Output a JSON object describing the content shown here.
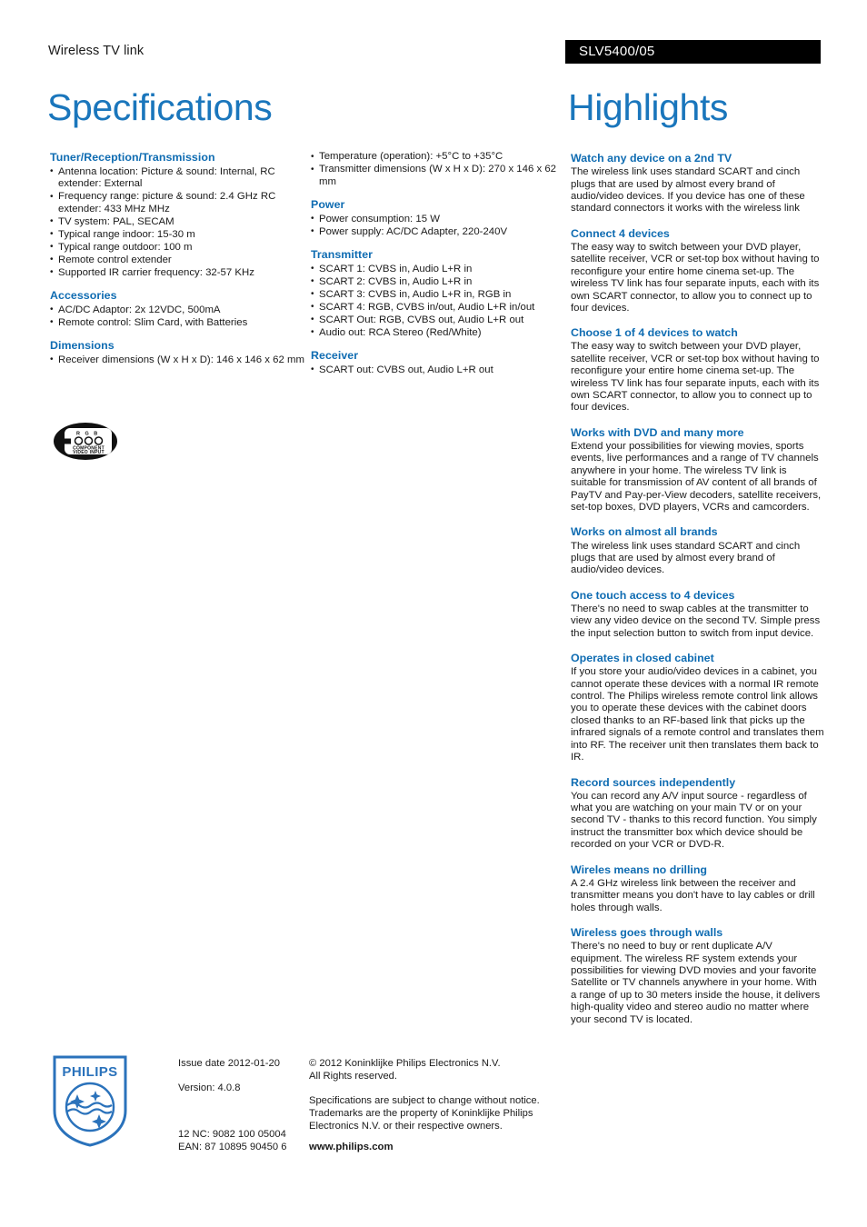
{
  "header": {
    "kicker": "Wireless TV link",
    "product_code": "SLV5400/05"
  },
  "titles": {
    "specifications": "Specifications",
    "highlights": "Highlights"
  },
  "badge": {
    "label_r": "R",
    "label_g": "G",
    "label_b": "B",
    "line1": "COMPONENT",
    "line2": "VIDEO INPUT"
  },
  "colors": {
    "title_blue": "#1a76bc",
    "heading_blue": "#0f6cb2",
    "code_bar_bg": "#000000",
    "logo_blue": "#2a72bb"
  },
  "spec_sections": [
    {
      "column": "left",
      "heading": "Tuner/Reception/Transmission",
      "items": [
        "Antenna location: Picture & sound: Internal, RC extender: External",
        "Frequency range: picture & sound: 2.4 GHz RC extender: 433 MHz MHz",
        "TV system: PAL, SECAM",
        "Typical range indoor: 15-30 m",
        "Typical range outdoor: 100 m",
        "Remote control extender",
        "Supported IR carrier frequency: 32-57 KHz"
      ]
    },
    {
      "column": "left",
      "heading": "Accessories",
      "items": [
        "AC/DC Adaptor: 2x 12VDC, 500mA",
        "Remote control: Slim Card, with Batteries"
      ]
    },
    {
      "column": "left",
      "heading": "Dimensions",
      "items": [
        "Receiver dimensions (W x H x D): 146 x 146 x 62 mm"
      ]
    },
    {
      "column": "mid",
      "heading": "",
      "items": [
        "Temperature (operation): +5°C to +35°C",
        "Transmitter dimensions (W x H x D): 270 x 146 x 62 mm"
      ]
    },
    {
      "column": "mid",
      "heading": "Power",
      "items": [
        "Power consumption: 15 W",
        "Power supply: AC/DC Adapter, 220-240V"
      ]
    },
    {
      "column": "mid",
      "heading": "Transmitter",
      "items": [
        "SCART 1: CVBS in, Audio L+R in",
        "SCART 2: CVBS in, Audio L+R in",
        "SCART 3: CVBS in, Audio L+R in, RGB in",
        "SCART 4: RGB, CVBS in/out, Audio L+R in/out",
        "SCART Out: RGB, CVBS out, Audio L+R out",
        "Audio out: RCA Stereo (Red/White)"
      ]
    },
    {
      "column": "mid",
      "heading": "Receiver",
      "items": [
        "SCART out: CVBS out, Audio L+R out"
      ]
    }
  ],
  "highlights": [
    {
      "title": "Watch any device on a 2nd TV",
      "body": "The wireless link uses standard SCART and cinch plugs that are used by almost every brand of audio/video devices. If you device has one of these standard connectors it works with the wireless link"
    },
    {
      "title": "Connect 4 devices",
      "body": "The easy way to switch between your DVD player, satellite receiver, VCR or set-top box without having to reconfigure your entire home cinema set-up. The wireless TV link has four separate inputs, each with its own SCART connector, to allow you to connect up to four devices."
    },
    {
      "title": "Choose 1 of 4 devices to watch",
      "body": "The easy way to switch between your DVD player, satellite receiver, VCR or set-top box without having to reconfigure your entire home cinema set-up. The wireless TV link has four separate inputs, each with its own SCART connector, to allow you to connect up to four devices."
    },
    {
      "title": "Works with DVD and many more",
      "body": "Extend your possibilities for viewing movies, sports events, live performances and a range of TV channels anywhere in your home. The wireless TV link is suitable for transmission of AV content of all brands of PayTV and Pay-per-View decoders, satellite receivers, set-top boxes, DVD players, VCRs and camcorders."
    },
    {
      "title": "Works on almost all brands",
      "body": "The wireless link uses standard SCART and cinch plugs that are used by almost every brand of audio/video devices."
    },
    {
      "title": "One touch access to 4 devices",
      "body": "There's no need to swap cables at the transmitter to view any video device on the second TV. Simple press the input selection button to switch from input device."
    },
    {
      "title": "Operates in closed cabinet",
      "body": "If you store your audio/video devices in a cabinet, you cannot operate these devices with a normal IR remote control. The Philips wireless remote control link allows you to operate these devices with the cabinet doors closed thanks to an RF-based link that picks up the infrared signals of a remote control and translates them into RF. The receiver unit then translates them back to IR."
    },
    {
      "title": "Record sources independently",
      "body": "You can record any A/V input source - regardless of what you are watching on your main TV or on your second TV - thanks to this record function. You simply instruct the transmitter box which device should be recorded on your VCR or DVD-R."
    },
    {
      "title": "Wireles means no drilling",
      "body": "A 2.4 GHz wireless link between the receiver and transmitter means you don't have to lay cables or drill holes through walls."
    },
    {
      "title": "Wireless goes through walls",
      "body": "There's no need to buy or rent duplicate A/V equipment. The wireless RF system extends your possibilities for viewing DVD movies and your favorite Satellite or TV channels anywhere in your home. With a range of up to 30 meters inside the house, it delivers high-quality video and stereo audio no matter where your second TV is located."
    }
  ],
  "footer": {
    "issue_date": "Issue date 2012-01-20",
    "version": "Version: 4.0.8",
    "nc_code": "12 NC: 9082 100 05004",
    "ean": "EAN: 87 10895 90450 6",
    "copyright_line1": "© 2012 Koninklijke Philips Electronics N.V.",
    "copyright_line2": "All Rights reserved.",
    "disclaimer": "Specifications are subject to change without notice. Trademarks are the property of Koninklijke Philips Electronics N.V. or their respective owners.",
    "website": "www.philips.com",
    "logo_wordmark": "PHILIPS"
  }
}
